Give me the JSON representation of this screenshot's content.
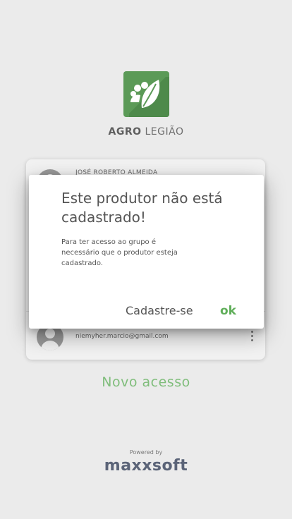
{
  "app": {
    "name_bold": "AGRO",
    "name_rest": "LEGIÃO"
  },
  "accounts": [
    {
      "name": "JOSÉ ROBERTO ALMEIDA",
      "email": ""
    },
    {
      "name": "",
      "email": "niemyher.marcio@gmail.com"
    }
  ],
  "new_access_label": "Novo acesso",
  "dialog": {
    "title": "Este produtor não está cadastrado!",
    "message": "Para ter acesso ao grupo é necessário que o produtor esteja cadastrado.",
    "register_label": "Cadastre-se",
    "ok_label": "ok"
  },
  "footer": {
    "powered_by": "Powered by",
    "brand": "maxxsoft"
  },
  "colors": {
    "accent": "#5fae59",
    "logo_bg": "#5b9a57",
    "background": "#ebebeb"
  }
}
